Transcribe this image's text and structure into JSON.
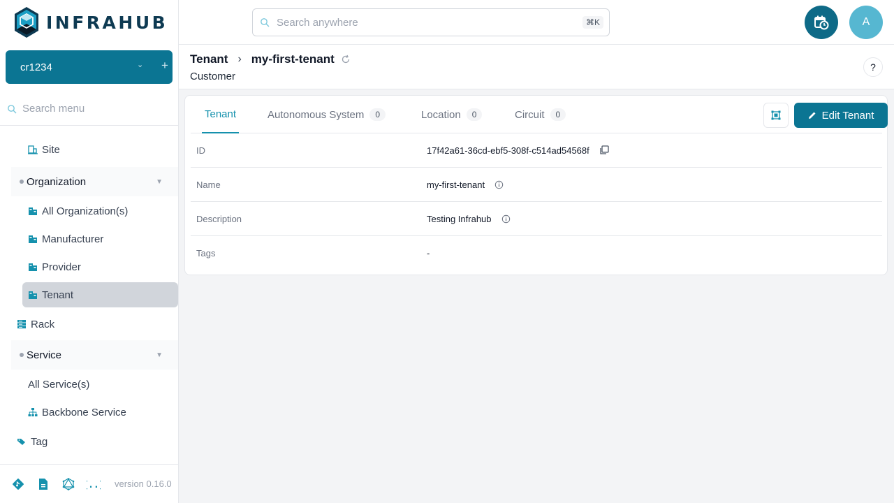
{
  "app": {
    "logo_text": "INFRAHUB"
  },
  "branch": {
    "name": "cr1234",
    "chevron": "chevron-down-icon",
    "add": "plus-icon"
  },
  "menu_search": {
    "placeholder": "Search menu"
  },
  "menu": {
    "site": "Site",
    "organization_group": "Organization",
    "all_organizations": "All Organization(s)",
    "manufacturer": "Manufacturer",
    "provider": "Provider",
    "tenant": "Tenant",
    "rack": "Rack",
    "service_group": "Service",
    "all_services": "All Service(s)",
    "backbone_service": "Backbone Service",
    "tag": "Tag"
  },
  "footer": {
    "version": "version 0.16.0"
  },
  "topbar": {
    "search_placeholder": "Search anywhere",
    "shortcut": "⌘K",
    "avatar_initial": "A"
  },
  "header": {
    "crumb_parent": "Tenant",
    "crumb_separator": "›",
    "crumb_current": "my-first-tenant",
    "subtitle": "Customer",
    "help": "?"
  },
  "tabs": [
    {
      "label": "Tenant",
      "count": null
    },
    {
      "label": "Autonomous System",
      "count": "0"
    },
    {
      "label": "Location",
      "count": "0"
    },
    {
      "label": "Circuit",
      "count": "0"
    }
  ],
  "actions": {
    "edit": "Edit Tenant"
  },
  "details": [
    {
      "label": "ID",
      "value": "17f42a61-36cd-ebf5-308f-c514ad54568f"
    },
    {
      "label": "Name",
      "value": "my-first-tenant"
    },
    {
      "label": "Description",
      "value": "Testing Infrahub"
    },
    {
      "label": "Tags",
      "value": "-"
    }
  ],
  "colors": {
    "primary": "#0b7593",
    "accent": "#1591ad",
    "avatar": "#56b7d1",
    "logo": "#0e3a52"
  }
}
